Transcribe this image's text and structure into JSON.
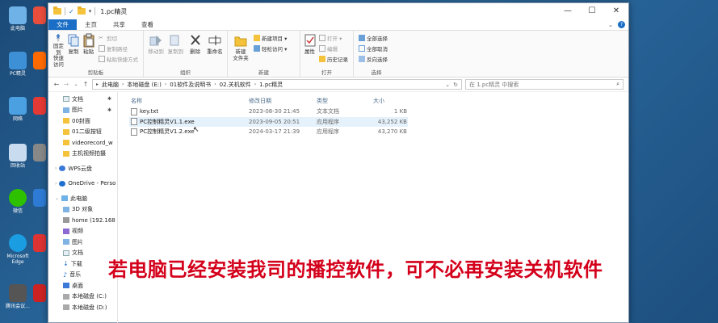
{
  "window": {
    "title": "1.pc精灵",
    "controls": {
      "minimize": "—",
      "maximize": "☐",
      "close": "✕"
    }
  },
  "ribbon_tabs": [
    "文件",
    "主页",
    "共享",
    "查看"
  ],
  "ribbon": {
    "clipboard": {
      "label": "剪贴板",
      "pin": "固定到\n快速访问",
      "copy": "复制",
      "paste": "粘贴",
      "cut": "剪切",
      "copy_path": "复制路径",
      "paste_shortcut": "粘贴快捷方式"
    },
    "organize": {
      "label": "组织",
      "move_to": "移动到",
      "copy_to": "复制到",
      "delete": "删除",
      "rename": "重命名"
    },
    "new": {
      "label": "新建",
      "new_folder": "新建\n文件夹",
      "new_item": "新建项目 ▾",
      "easy_access": "轻松访问 ▾"
    },
    "open": {
      "label": "打开",
      "properties": "属性",
      "open": "打开 ▾",
      "edit": "编辑",
      "history": "历史记录"
    },
    "select": {
      "label": "选择",
      "select_all": "全部选择",
      "select_none": "全部取消",
      "invert": "反向选择"
    }
  },
  "address": {
    "crumbs": [
      "此电脑",
      "本地磁盘 (E:)",
      "01软件及说明书",
      "02.关机软件",
      "1.pc精灵"
    ],
    "search_placeholder": "在 1.pc精灵 中搜索"
  },
  "nav": [
    {
      "label": "文档",
      "pinned": true,
      "level": 2
    },
    {
      "label": "图片",
      "pinned": true,
      "level": 2
    },
    {
      "label": "00封面",
      "level": 2
    },
    {
      "label": "01二级按钮",
      "level": 2
    },
    {
      "label": "videorecord_w",
      "level": 2
    },
    {
      "label": "主机视频拍摄",
      "level": 2
    },
    {
      "label": "WPS云盘",
      "level": 1
    },
    {
      "label": "OneDrive - Perso",
      "level": 1
    },
    {
      "label": "此电脑",
      "level": 1
    },
    {
      "label": "3D 对象",
      "level": 2
    },
    {
      "label": "home (192.168",
      "level": 2
    },
    {
      "label": "视频",
      "level": 2
    },
    {
      "label": "图片",
      "level": 2
    },
    {
      "label": "文档",
      "level": 2
    },
    {
      "label": "下载",
      "level": 2
    },
    {
      "label": "音乐",
      "level": 2
    },
    {
      "label": "桌面",
      "level": 2
    },
    {
      "label": "本地磁盘 (C:)",
      "level": 2
    },
    {
      "label": "本地磁盘 (D:)",
      "level": 2
    }
  ],
  "columns": [
    "名称",
    "修改日期",
    "类型",
    "大小"
  ],
  "files": [
    {
      "name": "key.txt",
      "date": "2023-08-30 21:45",
      "type": "文本文档",
      "size": "1 KB"
    },
    {
      "name": "PC控制精灵V1.1.exe",
      "date": "2023-09-05 20:51",
      "type": "应用程序",
      "size": "43,252 KB"
    },
    {
      "name": "PC控制精灵V1.2.exe",
      "date": "2024-03-17 21:39",
      "type": "应用程序",
      "size": "43,270 KB"
    }
  ],
  "caption": "若电脑已经安装我司的播控软件，可不必再安装关机软件",
  "desktop_icons": [
    "此电脑",
    "PC精灵",
    "网络",
    "回收站",
    "微信",
    "Microsoft Edge",
    "腾讯会议..."
  ],
  "colors": {
    "accent": "#1a6ec5",
    "caption": "#d4001b",
    "selection": "#e5f1fb"
  }
}
